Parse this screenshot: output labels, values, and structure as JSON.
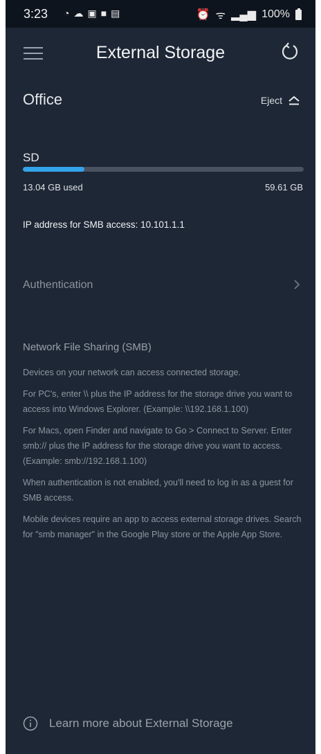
{
  "status_bar": {
    "time": "3:23",
    "battery": "100%"
  },
  "header": {
    "title": "External Storage",
    "menu_icon": "hamburger-menu-icon",
    "refresh_icon": "refresh-icon"
  },
  "device": {
    "name": "Office",
    "eject_label": "Eject"
  },
  "storage": {
    "drive_label": "SD",
    "used": "13.04 GB used",
    "total": "59.61 GB",
    "used_fraction": 0.22,
    "bar_color": "#34a4ea"
  },
  "ip": {
    "text": "IP address for SMB access: 10.101.1.1"
  },
  "authentication": {
    "label": "Authentication"
  },
  "smb": {
    "title": "Network File Sharing (SMB)",
    "paragraphs": [
      "Devices on your network can access connected storage.",
      "For PC's, enter \\\\ plus the IP address for the storage drive you want to access into Windows Explorer. (Example: \\\\192.168.1.100)",
      "For Macs, open Finder and navigate to Go > Connect to Server. Enter smb:// plus the IP address for the storage drive you want to access. (Example: smb://192.168.1.100)",
      "When authentication is not enabled, you'll need to log in as a guest for SMB access.",
      "Mobile devices require an app to access external storage drives. Search for \"smb manager\" in the Google Play store or the Apple App Store."
    ]
  },
  "footer": {
    "learn_more": "Learn more about External Storage"
  },
  "colors": {
    "background": "#1e2735",
    "status_bar": "#0e141d",
    "accent": "#34a4ea"
  }
}
